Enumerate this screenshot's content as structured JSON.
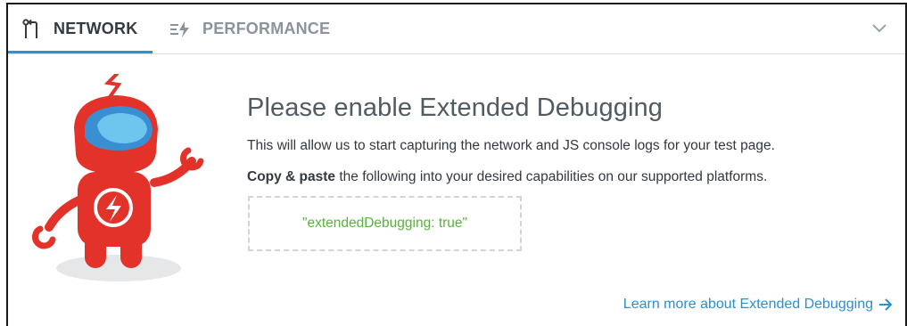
{
  "tabs": {
    "network": {
      "label": "NETWORK",
      "icon": "network-icon",
      "active": true
    },
    "performance": {
      "label": "PERFORMANCE",
      "icon": "performance-icon",
      "active": false
    }
  },
  "header": {
    "collapse_icon": "chevron-down-icon"
  },
  "main": {
    "heading": "Please enable Extended Debugging",
    "description": "This will allow us to start capturing the network and JS console logs for your test page.",
    "instruction_bold": "Copy & paste",
    "instruction_rest": " the following into your desired capabilities on our supported platforms.",
    "code": "\"extendedDebugging: true\"",
    "learn_more": "Learn more about Extended Debugging"
  },
  "colors": {
    "accent": "#2f8fd1",
    "robot_red": "#e2322a",
    "code_green": "#56b33a",
    "text_dark": "#33393f"
  }
}
